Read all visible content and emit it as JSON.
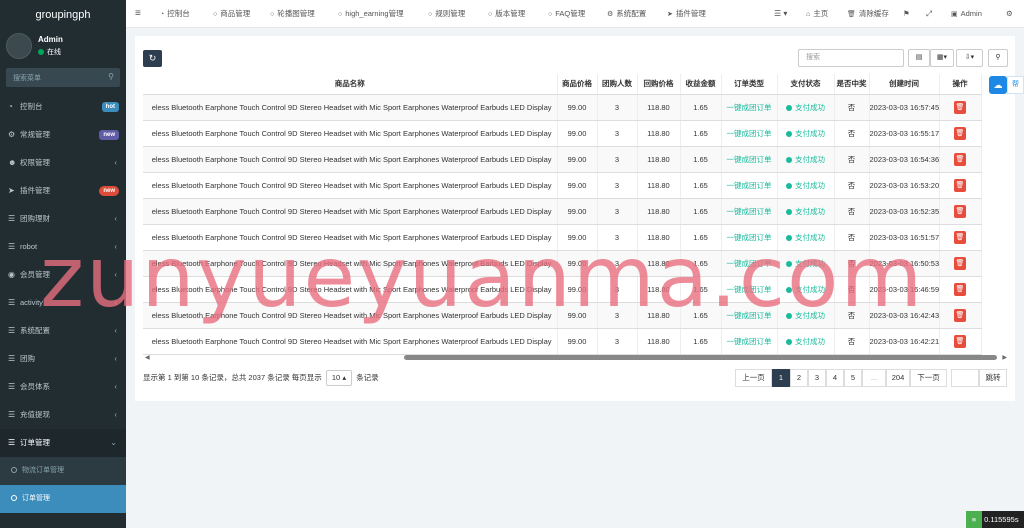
{
  "brand": "groupingph",
  "user": {
    "name": "Admin",
    "status": "在线"
  },
  "sidebar_search_placeholder": "搜索菜单",
  "sidebar": {
    "items": [
      {
        "label": "控制台",
        "icon": "dashboard-icon",
        "badge": "hot"
      },
      {
        "label": "常规管理",
        "icon": "gears-icon",
        "badge": "new"
      },
      {
        "label": "权限管理",
        "icon": "group-icon",
        "chevron": "<"
      },
      {
        "label": "插件管理",
        "icon": "rocket-icon",
        "badge": "new"
      },
      {
        "label": "团购理财",
        "icon": "list-icon",
        "chevron": "<"
      },
      {
        "label": "robot",
        "icon": "list-icon",
        "chevron": "<"
      },
      {
        "label": "会员管理",
        "icon": "user-icon",
        "chevron": "<"
      },
      {
        "label": "activity",
        "icon": "list-icon",
        "chevron": "<"
      },
      {
        "label": "系统配置",
        "icon": "list-icon",
        "chevron": "<"
      },
      {
        "label": "团购",
        "icon": "list-icon",
        "chevron": "<"
      },
      {
        "label": "会员体系",
        "icon": "list-icon",
        "chevron": "<"
      },
      {
        "label": "充值提现",
        "icon": "list-icon",
        "chevron": "<"
      },
      {
        "label": "订单管理",
        "icon": "list-icon",
        "chevron": "v"
      }
    ],
    "subitems": [
      {
        "label": "物流订单管理"
      },
      {
        "label": "订单管理"
      }
    ]
  },
  "topnav": {
    "menu_icon": "≡",
    "tabs": [
      {
        "label": "控制台",
        "icon": "dashboard-icon"
      },
      {
        "label": "商品管理",
        "icon": "circle-icon"
      },
      {
        "label": "轮播图管理",
        "icon": "circle-icon"
      },
      {
        "label": "high_earning管理",
        "icon": "circle-icon"
      },
      {
        "label": "规则管理",
        "icon": "circle-icon"
      },
      {
        "label": "版本管理",
        "icon": "circle-icon"
      },
      {
        "label": "FAQ管理",
        "icon": "circle-icon"
      },
      {
        "label": "系统配置",
        "icon": "gear-icon"
      },
      {
        "label": "插件管理",
        "icon": "rocket-icon"
      }
    ],
    "right": {
      "home": "主页",
      "clear_cache": "清除缓存",
      "admin": "Admin"
    }
  },
  "toolbar": {
    "search_placeholder": "搜索"
  },
  "table": {
    "columns": [
      "商品名称",
      "商品价格",
      "团购人数",
      "回购价格",
      "收益金额",
      "订单类型",
      "支付状态",
      "是否中奖",
      "创建时间",
      "操作"
    ],
    "rows": [
      [
        "eless Bluetooth Earphone Touch Control 9D Stereo Headset with Mic Sport Earphones Waterproof Earbuds LED Display",
        "99.00",
        "3",
        "118.80",
        "1.65",
        "一键成团订单",
        "支付成功",
        "否",
        "2023-03-03 16:57:45"
      ],
      [
        "eless Bluetooth Earphone Touch Control 9D Stereo Headset with Mic Sport Earphones Waterproof Earbuds LED Display",
        "99.00",
        "3",
        "118.80",
        "1.65",
        "一键成团订单",
        "支付成功",
        "否",
        "2023-03-03 16:55:17"
      ],
      [
        "eless Bluetooth Earphone Touch Control 9D Stereo Headset with Mic Sport Earphones Waterproof Earbuds LED Display",
        "99.00",
        "3",
        "118.80",
        "1.65",
        "一键成团订单",
        "支付成功",
        "否",
        "2023-03-03 16:54:36"
      ],
      [
        "eless Bluetooth Earphone Touch Control 9D Stereo Headset with Mic Sport Earphones Waterproof Earbuds LED Display",
        "99.00",
        "3",
        "118.80",
        "1.65",
        "一键成团订单",
        "支付成功",
        "否",
        "2023-03-03 16:53:20"
      ],
      [
        "eless Bluetooth Earphone Touch Control 9D Stereo Headset with Mic Sport Earphones Waterproof Earbuds LED Display",
        "99.00",
        "3",
        "118.80",
        "1.65",
        "一键成团订单",
        "支付成功",
        "否",
        "2023-03-03 16:52:35"
      ],
      [
        "eless Bluetooth Earphone Touch Control 9D Stereo Headset with Mic Sport Earphones Waterproof Earbuds LED Display",
        "99.00",
        "3",
        "118.80",
        "1.65",
        "一键成团订单",
        "支付成功",
        "否",
        "2023-03-03 16:51:57"
      ],
      [
        "eless Bluetooth Earphone Touch Control 9D Stereo Headset with Mic Sport Earphones Waterproof Earbuds LED Display",
        "99.00",
        "3",
        "118.80",
        "1.65",
        "一键成团订单",
        "支付成功",
        "否",
        "2023-03-03 16:50:53"
      ],
      [
        "eless Bluetooth Earphone Touch Control 9D Stereo Headset with Mic Sport Earphones Waterproof Earbuds LED Display",
        "99.00",
        "3",
        "118.80",
        "1.65",
        "一键成团订单",
        "支付成功",
        "否",
        "2023-03-03 16:46:59"
      ],
      [
        "eless Bluetooth Earphone Touch Control 9D Stereo Headset with Mic Sport Earphones Waterproof Earbuds LED Display",
        "99.00",
        "3",
        "118.80",
        "1.65",
        "一键成团订单",
        "支付成功",
        "否",
        "2023-03-03 16:42:43"
      ],
      [
        "eless Bluetooth Earphone Touch Control 9D Stereo Headset with Mic Sport Earphones Waterproof Earbuds LED Display",
        "99.00",
        "3",
        "118.80",
        "1.65",
        "一键成团订单",
        "支付成功",
        "否",
        "2023-03-03 16:42:21"
      ]
    ]
  },
  "pageinfo": {
    "text": "显示第 1 到第 10 条记录，总共 2037 条记录 每页显示",
    "page_size": "10",
    "suffix": "条记录"
  },
  "pagination": {
    "prev": "上一页",
    "pages": [
      "1",
      "2",
      "3",
      "4",
      "5",
      "...",
      "204"
    ],
    "next": "下一页",
    "jump": "跳转"
  },
  "float_widget": {
    "text": "帮"
  },
  "timer": "0.115595s",
  "watermark": "zunyueyuanma.com",
  "colors": {
    "sidebar": "#222d32",
    "active": "#3c8dbc",
    "success": "#18bc9c",
    "danger": "#e74c3c",
    "dark_button": "#2c3e50"
  }
}
